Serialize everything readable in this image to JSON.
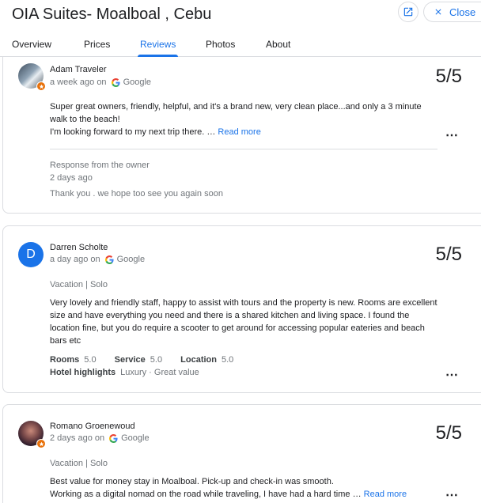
{
  "header": {
    "title": "OIA Suites- Moalboal , Cebu",
    "close_label": "Close"
  },
  "tabs": [
    {
      "label": "Overview"
    },
    {
      "label": "Prices"
    },
    {
      "label": "Reviews"
    },
    {
      "label": "Photos"
    },
    {
      "label": "About"
    }
  ],
  "active_tab": "Reviews",
  "reviews": [
    {
      "name": "Adam Traveler",
      "time": "a week ago on",
      "source": "Google",
      "rating": "5/5",
      "text": "Super great owners, friendly, helpful, and it's a brand new, very clean place...and only a 3 minute walk to the beach!",
      "text2": "I'm looking forward to my next trip there. …",
      "read_more": "Read more",
      "response_label": "Response from the owner",
      "response_time": "2 days ago",
      "response_text": "Thank you . we hope too see you again soon"
    },
    {
      "name": "Darren Scholte",
      "avatar_letter": "D",
      "time": "a day ago on",
      "source": "Google",
      "rating": "5/5",
      "trip": "Vacation | Solo",
      "text": "Very lovely and friendly staff, happy to assist with tours and the property is new. Rooms are excellent size and have everything you need and there is a shared kitchen and living space. I found the location fine, but you do require a scooter to get around for accessing popular eateries and beach bars etc",
      "sub_ratings": [
        {
          "label": "Rooms",
          "value": "5.0"
        },
        {
          "label": "Service",
          "value": "5.0"
        },
        {
          "label": "Location",
          "value": "5.0"
        }
      ],
      "highlights_label": "Hotel highlights",
      "highlights": "Luxury · Great value"
    },
    {
      "name": "Romano Groenewoud",
      "time": "2 days ago on",
      "source": "Google",
      "rating": "5/5",
      "trip": "Vacation | Solo",
      "text": "Best value for money stay in Moalboal. Pick-up and check-in was smooth.",
      "text2": "Working as a digital nomad on the road while traveling, I have had a hard time …",
      "read_more": "Read more"
    }
  ],
  "colors": {
    "accent": "#1a73e8",
    "avatar_d": "#1a73e8",
    "badge": "#e8710a"
  }
}
